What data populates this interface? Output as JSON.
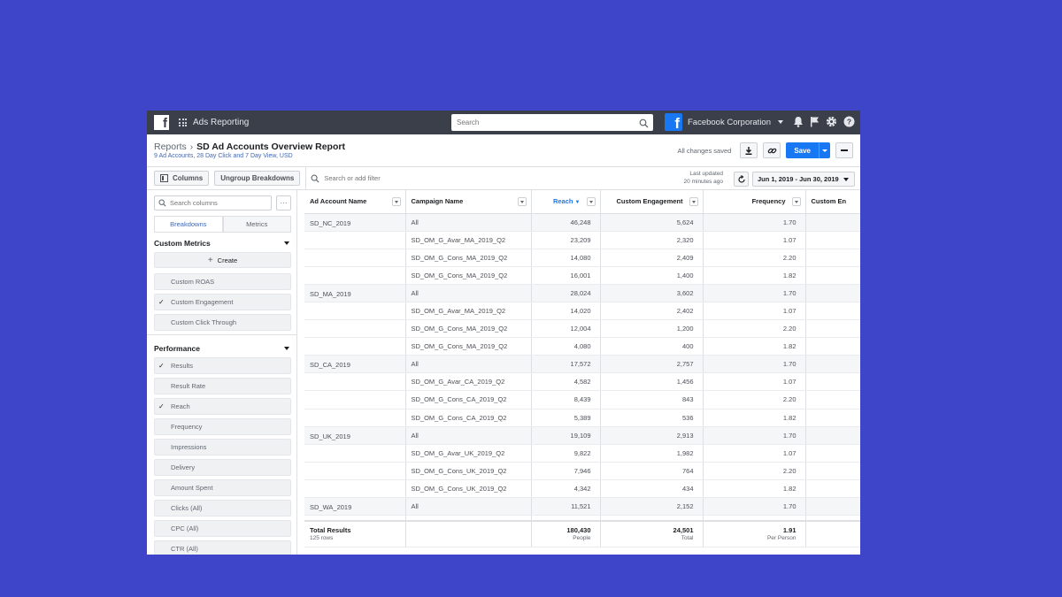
{
  "topbar": {
    "app_title": "Ads Reporting",
    "search_placeholder": "Search",
    "account_name": "Facebook Corporation"
  },
  "header": {
    "breadcrumb_root": "Reports",
    "report_title": "SD Ad Accounts Overview Report",
    "subtitle": "9 Ad Accounts, 28 Day Click and 7 Day View, USD",
    "saved_status": "All changes saved",
    "save_label": "Save"
  },
  "toolbar": {
    "columns_label": "Columns",
    "ungroup_label": "Ungroup Breakdowns",
    "filter_placeholder": "Search or add filter",
    "last_updated_line1": "Last updated",
    "last_updated_line2": "20 minutes ago",
    "date_range": "Jun 1, 2019 - Jun 30, 2019"
  },
  "sidebar": {
    "search_placeholder": "Search columns",
    "more_label": "···",
    "tabs": [
      "Breakdowns",
      "Metrics"
    ],
    "custom_metrics": {
      "title": "Custom Metrics",
      "create_label": "Create",
      "items": [
        {
          "label": "Custom ROAS",
          "checked": ""
        },
        {
          "label": "Custom Engagement",
          "checked": "✓"
        },
        {
          "label": "Custom Click Through",
          "checked": ""
        }
      ]
    },
    "performance": {
      "title": "Performance",
      "items": [
        {
          "label": "Results",
          "checked": "✓"
        },
        {
          "label": "Result Rate",
          "checked": ""
        },
        {
          "label": "Reach",
          "checked": "✓"
        },
        {
          "label": "Frequency",
          "checked": ""
        },
        {
          "label": "Impressions",
          "checked": ""
        },
        {
          "label": "Delivery",
          "checked": ""
        },
        {
          "label": "Amount Spent",
          "checked": ""
        },
        {
          "label": "Clicks (All)",
          "checked": ""
        },
        {
          "label": "CPC (All)",
          "checked": ""
        },
        {
          "label": "CTR (All)",
          "checked": ""
        }
      ]
    }
  },
  "table": {
    "columns": [
      "Ad Account Name",
      "Campaign Name",
      "Reach",
      "Custom Engagement",
      "Frequency",
      "Custom En"
    ],
    "reach_sort_indicator": "▼",
    "groups": [
      {
        "account": "SD_NC_2019",
        "all": [
          "All",
          "46,248",
          "5,624",
          "1.70"
        ],
        "rows": [
          [
            "SD_OM_G_Avar_MA_2019_Q2",
            "23,209",
            "2,320",
            "1.07"
          ],
          [
            "SD_OM_G_Cons_MA_2019_Q2",
            "14,080",
            "2,409",
            "2.20"
          ],
          [
            "SD_OM_G_Cons_MA_2019_Q2",
            "16,001",
            "1,400",
            "1.82"
          ]
        ]
      },
      {
        "account": "SD_MA_2019",
        "all": [
          "All",
          "28,024",
          "3,602",
          "1.70"
        ],
        "rows": [
          [
            "SD_OM_G_Avar_MA_2019_Q2",
            "14,020",
            "2,402",
            "1.07"
          ],
          [
            "SD_OM_G_Cons_MA_2019_Q2",
            "12,004",
            "1,200",
            "2.20"
          ],
          [
            "SD_OM_G_Cons_MA_2019_Q2",
            "4,080",
            "400",
            "1.82"
          ]
        ]
      },
      {
        "account": "SD_CA_2019",
        "all": [
          "All",
          "17,572",
          "2,757",
          "1.70"
        ],
        "rows": [
          [
            "SD_OM_G_Avar_CA_2019_Q2",
            "4,582",
            "1,456",
            "1.07"
          ],
          [
            "SD_OM_G_Cons_CA_2019_Q2",
            "8,439",
            "843",
            "2.20"
          ],
          [
            "SD_OM_G_Cons_CA_2019_Q2",
            "5,389",
            "536",
            "1.82"
          ]
        ]
      },
      {
        "account": "SD_UK_2019",
        "all": [
          "All",
          "19,109",
          "2,913",
          "1.70"
        ],
        "rows": [
          [
            "SD_OM_G_Avar_UK_2019_Q2",
            "9,822",
            "1,982",
            "1.07"
          ],
          [
            "SD_OM_G_Cons_UK_2019_Q2",
            "7,946",
            "764",
            "2.20"
          ],
          [
            "SD_OM_G_Cons_UK_2019_Q2",
            "4,342",
            "434",
            "1.82"
          ]
        ]
      },
      {
        "account": "SD_WA_2019",
        "all": [
          "All",
          "11,521",
          "2,152",
          "1.70"
        ],
        "rows": []
      }
    ],
    "totals": {
      "label": "Total Results",
      "rows_count": "125 rows",
      "reach": "180,430",
      "reach_unit": "People",
      "engagement": "24,501",
      "engagement_unit": "Total",
      "frequency": "1.91",
      "frequency_unit": "Per Person"
    }
  },
  "colors": {
    "background": "#3e45c8",
    "topbar": "#3a3f4a",
    "primary": "#1877f2"
  }
}
